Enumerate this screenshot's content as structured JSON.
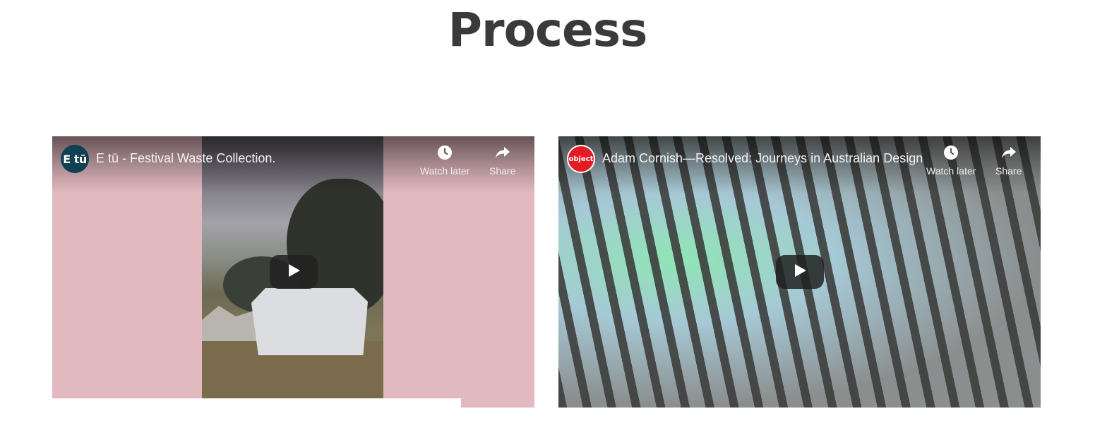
{
  "page": {
    "title": "Process"
  },
  "videos": [
    {
      "channel_avatar_text": "E tū",
      "title": "E tū - Festival Waste Collection.",
      "watch_later_label": "Watch later",
      "share_label": "Share",
      "icons": {
        "watch_later": "clock-icon",
        "share": "share-arrow-icon",
        "play": "play-icon"
      },
      "colors": {
        "background": "#e2b9bf",
        "avatar": "#0f4150"
      }
    },
    {
      "channel_avatar_text": "object",
      "title": "Adam Cornish—Resolved: Journeys in Australian Design",
      "watch_later_label": "Watch later",
      "share_label": "Share",
      "icons": {
        "watch_later": "clock-icon",
        "share": "share-arrow-icon",
        "play": "play-icon"
      },
      "colors": {
        "avatar": "#e31b23"
      }
    }
  ],
  "colors": {
    "heading": "#3a3a3a",
    "play_button": "#212121"
  }
}
